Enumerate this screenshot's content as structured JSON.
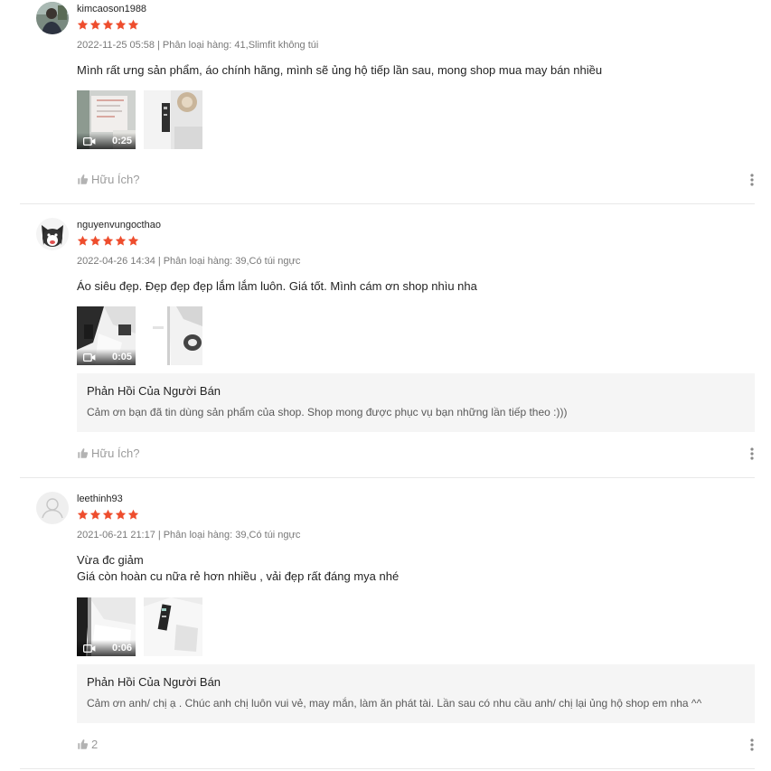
{
  "colors": {
    "star": "#ee4d2d",
    "divider": "#e8e8e8",
    "reply_bg": "#f5f5f5",
    "muted_text": "#8a8a8a"
  },
  "icons": {
    "star": "star-icon",
    "video": "video-camera-icon",
    "like": "thumbs-up-icon",
    "more": "more-vertical-icon",
    "default_avatar": "user-silhouette-icon"
  },
  "reviews": [
    {
      "username": "kimcaoson1988",
      "rating": 5,
      "date": "2022-11-25 05:58",
      "separator": "|",
      "variation": "Phân loại hàng: 41,Slimfit không túi",
      "comment_lines": [
        "Mình rất ưng sản phẩm, áo chính hãng, mình sẽ ủng hộ tiếp lần sau, mong shop mua may bán nhiều"
      ],
      "media": [
        {
          "type": "video",
          "duration": "0:25"
        },
        {
          "type": "image"
        }
      ],
      "like_label": "Hữu Ích?"
    },
    {
      "username": "nguyenvungocthao",
      "rating": 5,
      "date": "2022-04-26 14:34",
      "separator": "|",
      "variation": "Phân loại hàng: 39,Có túi ngực",
      "comment_lines": [
        "Áo siêu đẹp. Đẹp đẹp đẹp lắm lắm luôn. Giá tốt. Mình cám ơn shop nhìu nha"
      ],
      "media": [
        {
          "type": "video",
          "duration": "0:05"
        },
        {
          "type": "image"
        }
      ],
      "seller_reply": {
        "title": "Phản Hồi Của Người Bán",
        "text": "Cảm ơn bạn đã tin dùng sản phẩm của shop. Shop mong được phục vụ bạn những lần tiếp theo :)))"
      },
      "like_label": "Hữu Ích?"
    },
    {
      "username": "leethinh93",
      "rating": 5,
      "date": "2021-06-21 21:17",
      "separator": "|",
      "variation": "Phân loại hàng: 39,Có túi ngực",
      "comment_lines": [
        "Vừa đc giảm",
        "Giá còn hoàn cu nữa rẻ hơn nhiều , vải đẹp rất đáng mya nhé"
      ],
      "media": [
        {
          "type": "video",
          "duration": "0:06"
        },
        {
          "type": "image"
        }
      ],
      "seller_reply": {
        "title": "Phản Hồi Của Người Bán",
        "text": "Cảm ơn anh/ chị ạ . Chúc anh chị luôn vui vẻ, may mắn, làm ăn phát tài. Lần sau có nhu cầu anh/ chị lại ủng hộ shop em nha ^^"
      },
      "like_label": "2"
    }
  ]
}
